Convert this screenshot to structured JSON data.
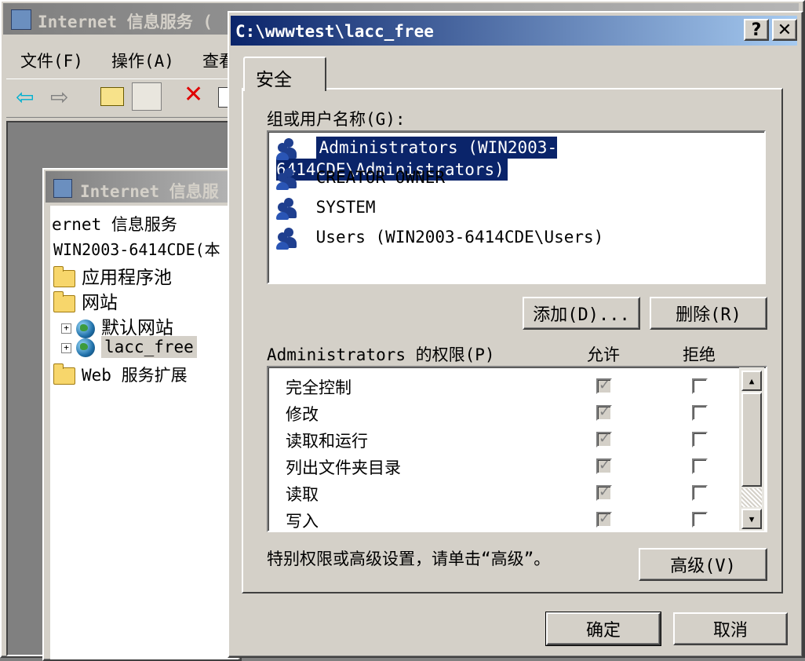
{
  "iis_main": {
    "title": "Internet 信息服务 (",
    "menu": [
      "文件(F)",
      "操作(A)",
      "查看"
    ]
  },
  "iis_child": {
    "title": "Internet 信息服",
    "tree": {
      "root": "ernet 信息服务",
      "server": "WIN2003-6414CDE(本",
      "app_pools": "应用程序池",
      "websites": "网站",
      "default_site": "默认网站",
      "site_lacc": "lacc_free",
      "web_ext": "Web 服务扩展"
    }
  },
  "dialog": {
    "title": "C:\\wwwtest\\lacc_free",
    "help_btn": "?",
    "close_btn": "✕",
    "tab_security": "安全",
    "groups_label": "组或用户名称(G):",
    "users": [
      "Administrators (WIN2003-6414CDE\\Administrators)",
      "CREATOR OWNER",
      "SYSTEM",
      "Users (WIN2003-6414CDE\\Users)"
    ],
    "add_btn": "添加(D)...",
    "remove_btn": "删除(R)",
    "perm_label": "Administrators 的权限(P)",
    "allow_header": "允许",
    "deny_header": "拒绝",
    "permissions": [
      "完全控制",
      "修改",
      "读取和运行",
      "列出文件夹目录",
      "读取",
      "写入"
    ],
    "advanced_hint": "特别权限或高级设置，请单击“高级”。",
    "advanced_btn": "高级(V)",
    "ok_btn": "确定",
    "cancel_btn": "取消"
  }
}
